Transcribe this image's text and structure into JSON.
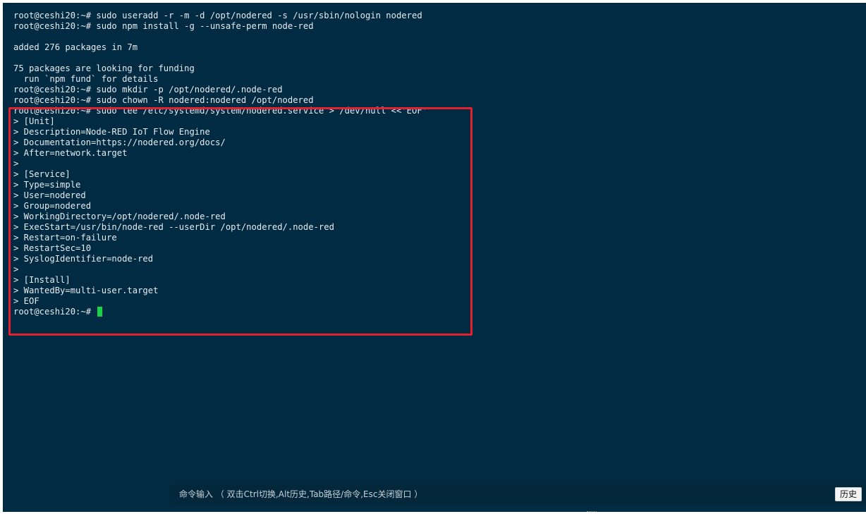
{
  "terminal": {
    "lines": [
      "root@ceshi20:~# sudo useradd -r -m -d /opt/nodered -s /usr/sbin/nologin nodered",
      "root@ceshi20:~# sudo npm install -g --unsafe-perm node-red",
      "",
      "added 276 packages in 7m",
      "",
      "75 packages are looking for funding",
      "  run `npm fund` for details",
      "root@ceshi20:~# sudo mkdir -p /opt/nodered/.node-red",
      "root@ceshi20:~# sudo chown -R nodered:nodered /opt/nodered",
      "root@ceshi20:~# sudo tee /etc/systemd/system/nodered.service > /dev/null <<'EOF'",
      "> [Unit]",
      "> Description=Node-RED IoT Flow Engine",
      "> Documentation=https://nodered.org/docs/",
      "> After=network.target",
      ">",
      "> [Service]",
      "> Type=simple",
      "> User=nodered",
      "> Group=nodered",
      "> WorkingDirectory=/opt/nodered/.node-red",
      "> ExecStart=/usr/bin/node-red --userDir /opt/nodered/.node-red",
      "> Restart=on-failure",
      "> RestartSec=10",
      "> SyslogIdentifier=node-red",
      ">",
      "> [Install]",
      "> WantedBy=multi-user.target",
      "> EOF"
    ],
    "prompt": "root@ceshi20:~# "
  },
  "command_bar": {
    "placeholder": "命令输入 （ 双击Ctrl切换,Alt历史,Tab路径/命令,Esc关闭窗口 ）",
    "history_label": "历史"
  },
  "colors": {
    "terminal_bg": "#012b43",
    "text": "#e6ecef",
    "cursor": "#18d448",
    "highlight_border": "#e5212f"
  }
}
